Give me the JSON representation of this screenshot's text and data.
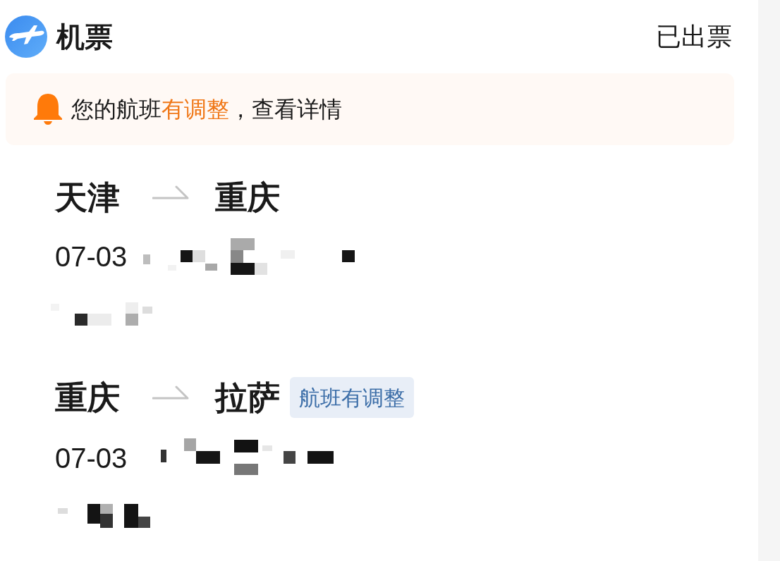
{
  "header": {
    "title": "机票",
    "status": "已出票"
  },
  "notice": {
    "segments": [
      {
        "text": "您的航班",
        "highlight": false
      },
      {
        "text": "有调整",
        "highlight": true
      },
      {
        "text": "，查看详情",
        "highlight": false
      }
    ]
  },
  "flights": [
    {
      "from": "天津",
      "to": "重庆",
      "date": "07-03"
    },
    {
      "from": "重庆",
      "to": "拉萨",
      "badge": "航班有调整",
      "date": "07-03"
    }
  ]
}
